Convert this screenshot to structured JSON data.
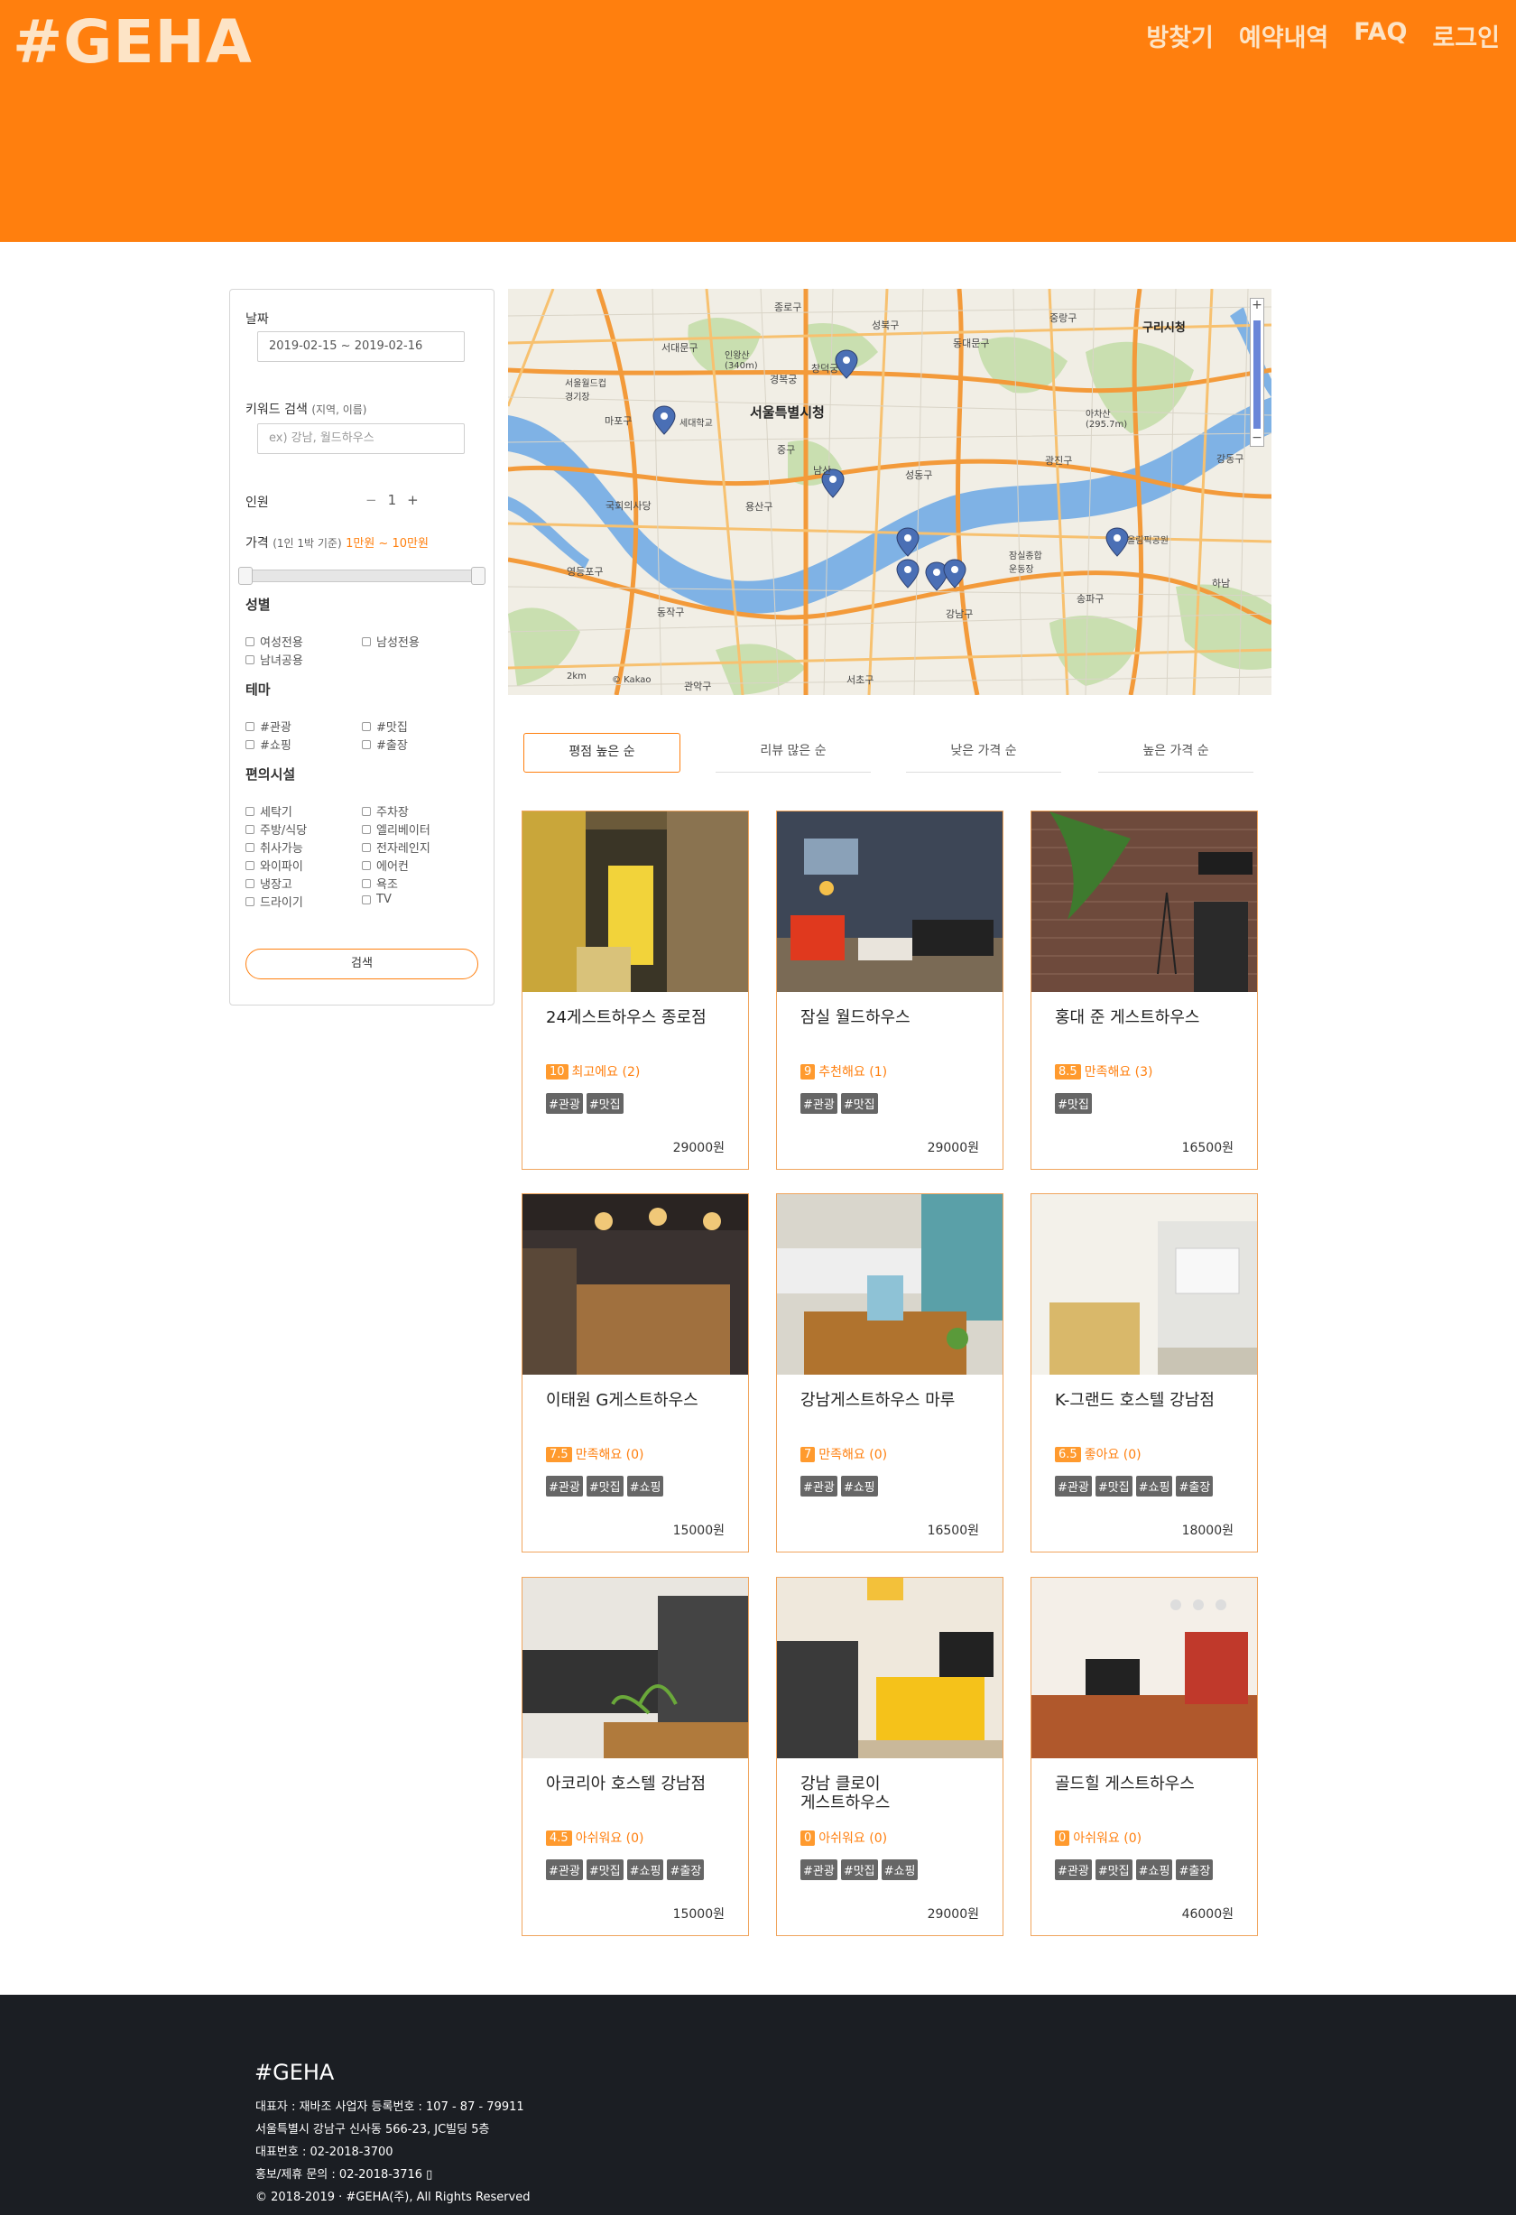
{
  "header": {
    "logo": "#GEHA",
    "nav": [
      "방찾기",
      "예약내역",
      "FAQ",
      "로그인"
    ]
  },
  "sidebar": {
    "date_label": "날짜",
    "date_value": "2019-02-15 ~ 2019-02-16",
    "keyword_label": "키워드 검색",
    "keyword_hint": "(지역, 이름)",
    "keyword_placeholder": "ex) 강남, 월드하우스",
    "people_label": "인원",
    "people_minus": "−",
    "people_value": "1",
    "people_plus": "+",
    "price_label": "가격",
    "price_hint": "(1인 1박 기준)",
    "price_range": "1만원 ~ 10만원",
    "gender_label": "성별",
    "gender_options": [
      "여성전용",
      "남성전용",
      "남녀공용"
    ],
    "theme_label": "테마",
    "theme_options": [
      "#관광",
      "#맛집",
      "#쇼핑",
      "#출장"
    ],
    "facility_label": "편의시설",
    "facility_options": [
      "세탁기",
      "주차장",
      "주방/식당",
      "엘리베이터",
      "취사가능",
      "전자레인지",
      "와이파이",
      "에어컨",
      "냉장고",
      "욕조",
      "드라이기",
      "TV"
    ],
    "search_button": "검색"
  },
  "map": {
    "labels": [
      "종로구",
      "성북구",
      "동대문구",
      "중랑구",
      "구리시청",
      "서대문구",
      "인왕산\n(340m)",
      "경복궁",
      "창덕궁",
      "서울특별시청",
      "서울월드컵\n경기장",
      "마포구",
      "세대학교",
      "중구",
      "아차산\n(295.7m)",
      "광진구",
      "남산",
      "국회의사당",
      "용산구",
      "성동구",
      "영등포구",
      "동작구",
      "강남구",
      "송파구",
      "서초구",
      "관악구",
      "강동구",
      "올림픽공원",
      "잠실종합\n운동장",
      "하남",
      "2km",
      "© Kakao"
    ]
  },
  "sort_tabs": [
    "평점 높은 순",
    "리뷰 많은 순",
    "낮은 가격 순",
    "높은 가격 순"
  ],
  "cards": [
    {
      "name": "24게스트하우스 종로점",
      "score": "10",
      "rating_text": "최고에요 (2)",
      "tags": [
        "#관광",
        "#맛집"
      ],
      "price": "29000원"
    },
    {
      "name": "잠실 월드하우스",
      "score": "9",
      "rating_text": "추천해요 (1)",
      "tags": [
        "#관광",
        "#맛집"
      ],
      "price": "29000원"
    },
    {
      "name": "홍대 준 게스트하우스",
      "score": "8.5",
      "rating_text": "만족해요 (3)",
      "tags": [
        "#맛집"
      ],
      "price": "16500원"
    },
    {
      "name": "이태원 G게스트하우스",
      "score": "7.5",
      "rating_text": "만족해요 (0)",
      "tags": [
        "#관광",
        "#맛집",
        "#쇼핑"
      ],
      "price": "15000원"
    },
    {
      "name": "강남게스트하우스 마루",
      "score": "7",
      "rating_text": "만족해요 (0)",
      "tags": [
        "#관광",
        "#쇼핑"
      ],
      "price": "16500원"
    },
    {
      "name": "K-그랜드 호스텔 강남점",
      "score": "6.5",
      "rating_text": "좋아요 (0)",
      "tags": [
        "#관광",
        "#맛집",
        "#쇼핑",
        "#출장"
      ],
      "price": "18000원"
    },
    {
      "name": "아코리아 호스텔 강남점",
      "score": "4.5",
      "rating_text": "아쉬워요 (0)",
      "tags": [
        "#관광",
        "#맛집",
        "#쇼핑",
        "#출장"
      ],
      "price": "15000원"
    },
    {
      "name": "강남 클로이\n게스트하우스",
      "score": "0",
      "rating_text": "아쉬워요 (0)",
      "tags": [
        "#관광",
        "#맛집",
        "#쇼핑"
      ],
      "price": "29000원"
    },
    {
      "name": "골드힐 게스트하우스",
      "score": "0",
      "rating_text": "아쉬워요 (0)",
      "tags": [
        "#관광",
        "#맛집",
        "#쇼핑",
        "#출장"
      ],
      "price": "46000원"
    }
  ],
  "footer": {
    "title": "#GEHA",
    "lines": [
      "대표자 : 재바조 사업자 등록번호 : 107 - 87 - 79911",
      "서울특별시 강남구 신사동 566-23, JC빌딩 5층",
      "대표번호 : 02-2018-3700",
      "홍보/제휴 문의 : 02-2018-3716 ▯",
      "© 2018-2019 · #GEHA(주), All Rights Reserved"
    ]
  },
  "colors": {
    "brand": "#ff7f0e",
    "footer": "#1b1e23"
  }
}
